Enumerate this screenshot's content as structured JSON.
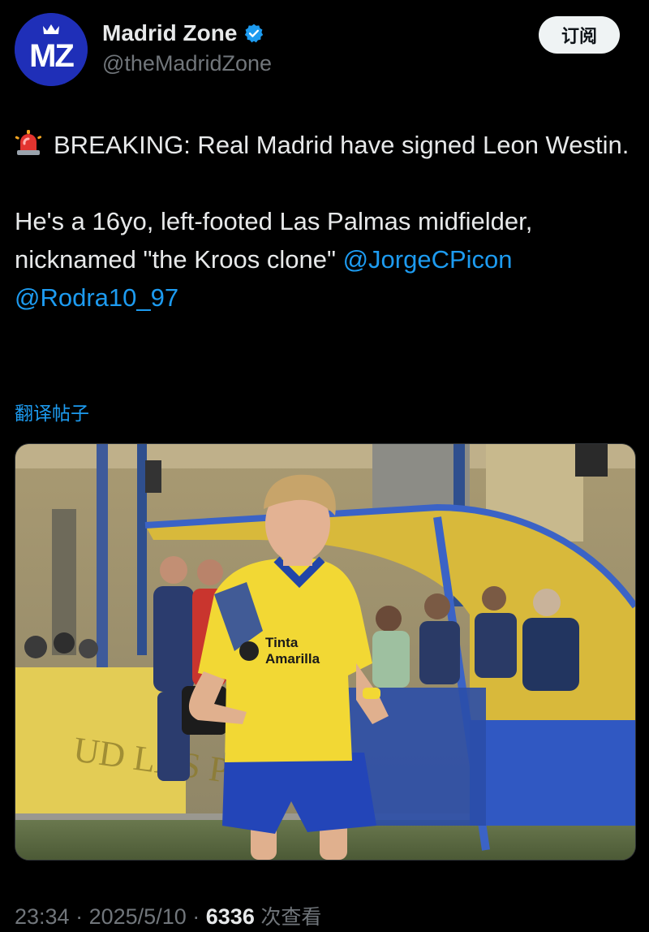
{
  "author": {
    "display_name": "Madrid Zone",
    "handle": "@theMadridZone",
    "avatar_text": "MZ",
    "verified": true
  },
  "actions": {
    "subscribe_label": "订阅"
  },
  "tweet": {
    "line1": "BREAKING: Real Madrid have signed Leon Westin.",
    "line2_text": "He's a 16yo, left-footed Las Palmas midfielder, nicknamed \"the Kroos clone\" ",
    "mention1": "@JorgeCPicon",
    "mention2": "@Rodra10_97",
    "translate_label": "翻译帖子",
    "emoji_icon": "rotating-light-icon"
  },
  "media": {
    "sponsor_line1": "Tinta",
    "sponsor_line2": "Amarilla",
    "banner_text": "UD LAS PA"
  },
  "meta": {
    "time": "23:34",
    "separator": "·",
    "date": "2025/5/10",
    "views_count": "6336",
    "views_label": "次查看"
  },
  "colors": {
    "background": "#000000",
    "text": "#e7e9ea",
    "secondary": "#71767b",
    "link": "#1d9bf0",
    "avatar": "#1f2fb8"
  }
}
